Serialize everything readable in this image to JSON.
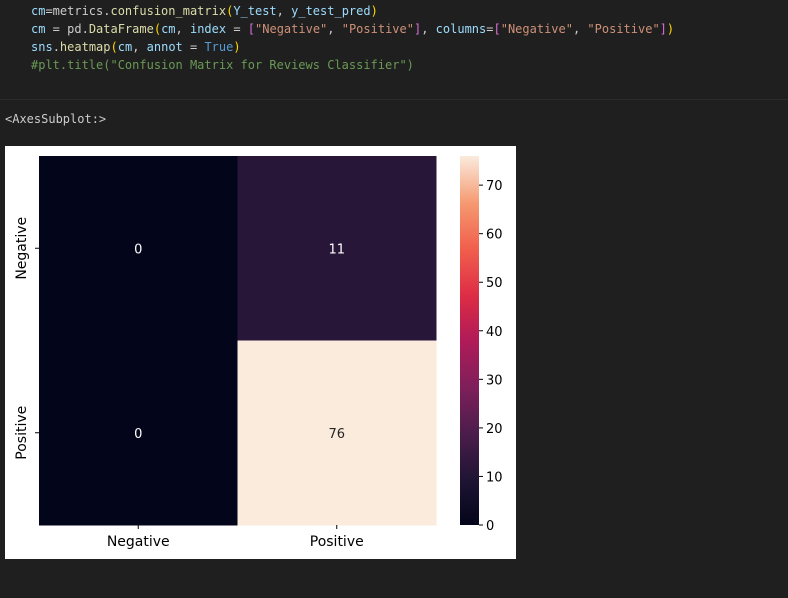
{
  "code_cell": {
    "lines": [
      [
        {
          "t": "cm",
          "c": "var"
        },
        {
          "t": "=metrics.",
          "c": "op"
        },
        {
          "t": "confusion_matrix",
          "c": "fn"
        },
        {
          "t": "(",
          "c": "paren"
        },
        {
          "t": "Y_test",
          "c": "var"
        },
        {
          "t": ", ",
          "c": "op"
        },
        {
          "t": "y_test_pred",
          "c": "var"
        },
        {
          "t": ")",
          "c": "paren"
        }
      ],
      [
        {
          "t": "cm",
          "c": "var"
        },
        {
          "t": " = pd.",
          "c": "op"
        },
        {
          "t": "DataFrame",
          "c": "fn"
        },
        {
          "t": "(",
          "c": "paren"
        },
        {
          "t": "cm",
          "c": "var"
        },
        {
          "t": ", ",
          "c": "op"
        },
        {
          "t": "index",
          "c": "var"
        },
        {
          "t": " = ",
          "c": "op"
        },
        {
          "t": "[",
          "c": "bracket"
        },
        {
          "t": "\"Negative\"",
          "c": "str"
        },
        {
          "t": ", ",
          "c": "op"
        },
        {
          "t": "\"Positive\"",
          "c": "str"
        },
        {
          "t": "]",
          "c": "bracket"
        },
        {
          "t": ", ",
          "c": "op"
        },
        {
          "t": "columns",
          "c": "var"
        },
        {
          "t": "=",
          "c": "op"
        },
        {
          "t": "[",
          "c": "bracket"
        },
        {
          "t": "\"Negative\"",
          "c": "str"
        },
        {
          "t": ", ",
          "c": "op"
        },
        {
          "t": "\"Positive\"",
          "c": "str"
        },
        {
          "t": "]",
          "c": "bracket"
        },
        {
          "t": ")",
          "c": "paren"
        }
      ],
      [
        {
          "t": "sns",
          "c": "var"
        },
        {
          "t": ".",
          "c": "op"
        },
        {
          "t": "heatmap",
          "c": "fn"
        },
        {
          "t": "(",
          "c": "paren"
        },
        {
          "t": "cm",
          "c": "var"
        },
        {
          "t": ", ",
          "c": "op"
        },
        {
          "t": "annot",
          "c": "var"
        },
        {
          "t": " = ",
          "c": "op"
        },
        {
          "t": "True",
          "c": "kw"
        },
        {
          "t": ")",
          "c": "paren"
        }
      ],
      [
        {
          "t": "#plt.title(\"Confusion Matrix for Reviews Classifier\")",
          "c": "comment"
        }
      ]
    ]
  },
  "output": {
    "repr_text": "<AxesSubplot:>"
  },
  "chart_data": {
    "type": "heatmap",
    "x_categories": [
      "Negative",
      "Positive"
    ],
    "y_categories": [
      "Negative",
      "Positive"
    ],
    "values": [
      [
        0,
        11
      ],
      [
        0,
        76
      ]
    ],
    "annotations": [
      [
        "0",
        "11"
      ],
      [
        "0",
        "76"
      ]
    ],
    "colorbar": {
      "min": 0,
      "max": 76,
      "ticks": [
        0,
        10,
        20,
        30,
        40,
        50,
        60,
        70
      ],
      "colormap": "rocket"
    },
    "title": "",
    "xlabel": "",
    "ylabel": ""
  }
}
